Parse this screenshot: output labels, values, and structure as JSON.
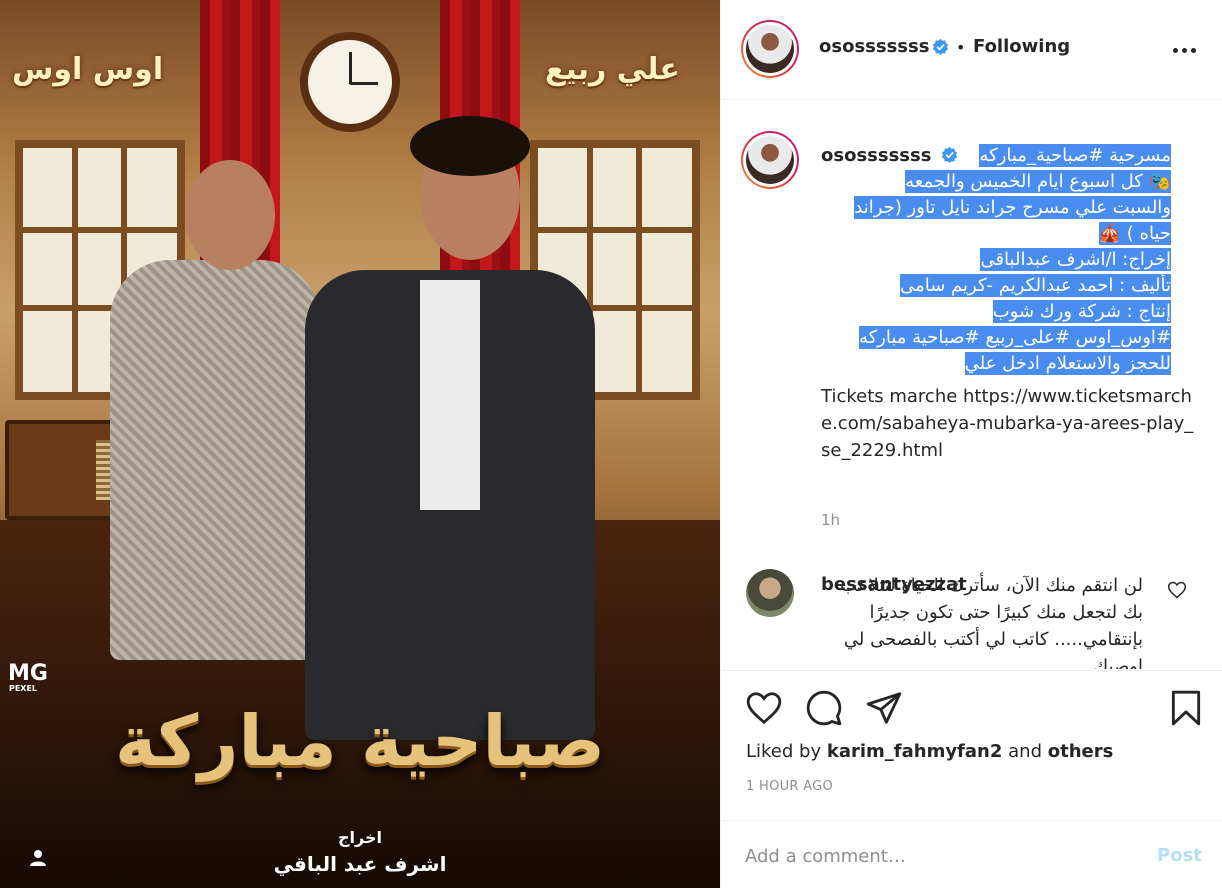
{
  "poster": {
    "name_left": "اوس اوس",
    "name_right": "علي ربيع",
    "logo_letters": "MG",
    "logo_sub": "PEXEL",
    "title": "صباحية مباركة",
    "credit_label": "اخراج",
    "credit_name": "اشرف عبد الباقي"
  },
  "header": {
    "username": "ososssssss",
    "separator": "•",
    "follow_status": "Following"
  },
  "caption": {
    "username": "ososssssss",
    "lines": [
      "مسرحية #صباحية_مباركه",
      "🎭 كل اسبوع ايام الخميس والجمعه",
      "والسبت علي مسرح جراند نايل تاور (جراند",
      "حياه ) 🎪",
      "إخراج: ا/اشرف عبدالباقى",
      "تأليف : احمد عبدالكريم -كريم سامى",
      "إنتاج : شركة ورك شوب",
      "#اوس_اوس #على_ربيع #صباحية مباركه",
      "للحجز والاستعلام ادخل علي"
    ],
    "ltr_text": "Tickets marche https://www.ticketsmarche.com/sabaheya-mubarka-ya-arees-play_se_2229.html",
    "time_ago": "1h"
  },
  "comment": {
    "username": "bessantyezzat",
    "text": "لن انتقم منك الآن، سأترك الحياة لتتلاعب بك لتجعل منك كبيرًا حتى تكون جديرًا بإنتقامي..... كاتب لي أكتب بالفصحى لي اوصيك"
  },
  "actions": {
    "liked_by_prefix": "Liked by",
    "liked_by_user": "karim_fahmyfan2",
    "liked_by_and": "and",
    "liked_by_others": "others",
    "post_age": "1 HOUR AGO"
  },
  "add_comment": {
    "placeholder": "Add a comment…",
    "post_label": "Post"
  },
  "colors": {
    "verified": "#3897f0",
    "highlight": "#4a8df0",
    "post_disabled": "#b2dffc",
    "muted": "#8e8e8e"
  }
}
